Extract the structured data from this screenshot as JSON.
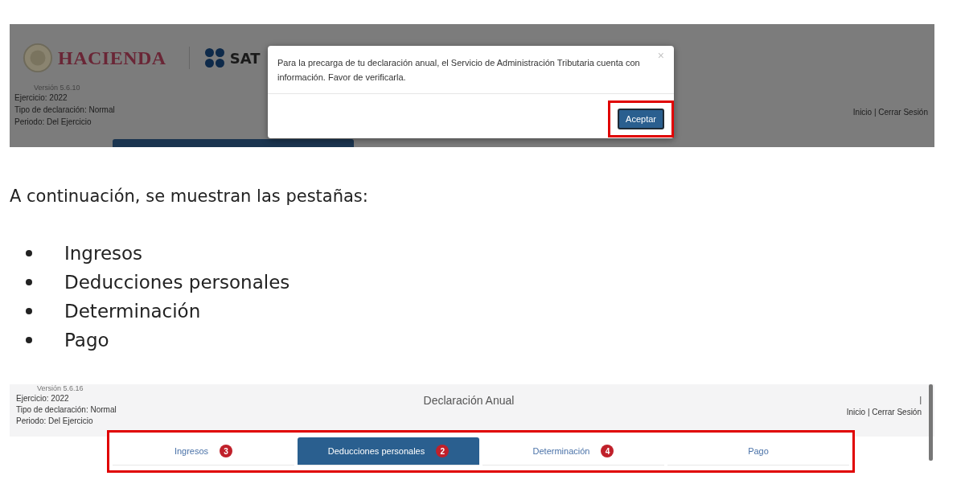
{
  "screenshot_1": {
    "logo_text": "HACIENDA",
    "sat_text": "SAT",
    "version": "Versión 5.6.10",
    "info": [
      "Ejercicio: 2022",
      "Tipo de declaración: Normal",
      "Periodo: Del Ejercicio"
    ],
    "links": "Inicio | Cerrar Sesión",
    "modal": {
      "message": "Para la precarga de tu declaración anual, el Servicio de Administración Tributaria cuenta con información. Favor de verificarla.",
      "close": "×",
      "button": "Aceptar",
      "button_highlighted": true
    }
  },
  "intro": "A continuación, se muestran las pestañas:",
  "bullets": [
    "Ingresos",
    "Deducciones personales",
    "Determinación",
    "Pago"
  ],
  "screenshot_2": {
    "version": "Versión 5.6.16",
    "info": [
      "Ejercicio: 2022",
      "Tipo de declaración: Normal",
      "Periodo: Del Ejercicio"
    ],
    "title": "Declaración Anual",
    "separator": "|",
    "links": "Inicio | Cerrar Sesión",
    "tabs_highlighted": true,
    "tabs": [
      {
        "label": "Ingresos",
        "badge": "3",
        "selected": false
      },
      {
        "label": "Deducciones personales",
        "badge": "2",
        "selected": true
      },
      {
        "label": "Determinación",
        "badge": "4",
        "selected": false
      },
      {
        "label": "Pago",
        "selected": false
      }
    ]
  }
}
